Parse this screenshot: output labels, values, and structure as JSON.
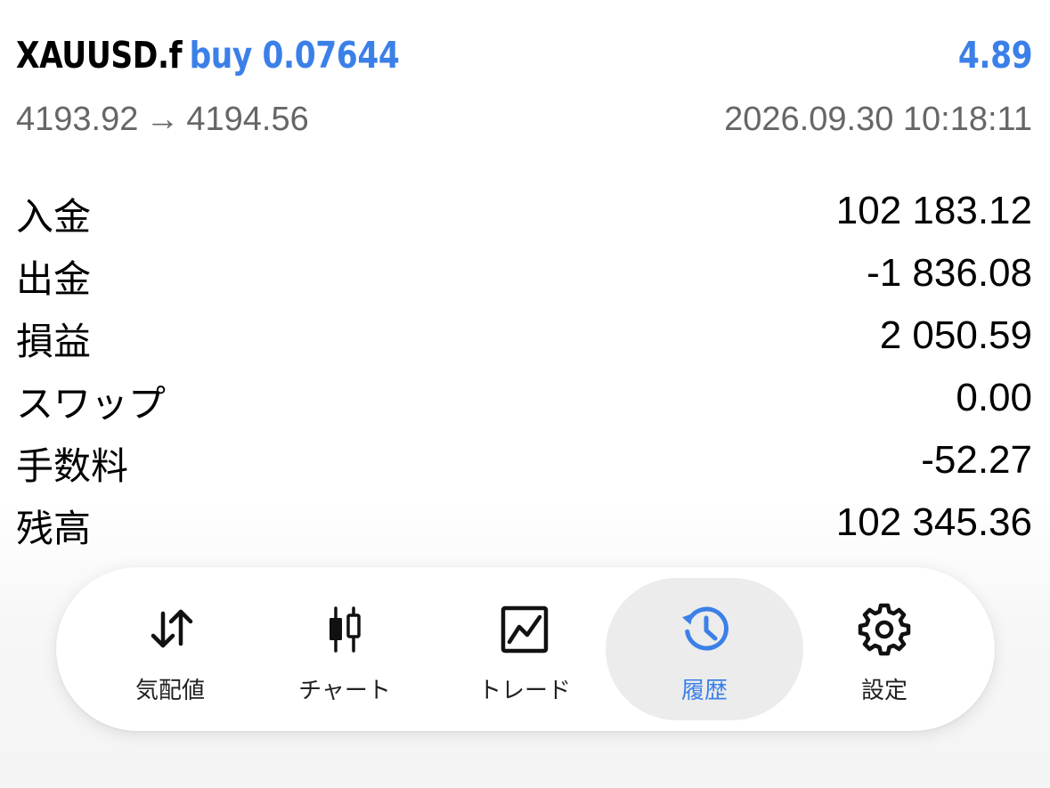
{
  "deal": {
    "symbol": "XAUUSD.f",
    "type_volume": "buy 0.07644",
    "profit": "4.89",
    "open_price": "4193.92",
    "arrow": "→",
    "close_price": "4194.56",
    "datetime": "2026.09.30 10:18:11"
  },
  "summary": [
    {
      "label": "入金",
      "value": "102 183.12"
    },
    {
      "label": "出金",
      "value": "-1 836.08"
    },
    {
      "label": "損益",
      "value": "2 050.59"
    },
    {
      "label": "スワップ",
      "value": "0.00"
    },
    {
      "label": "手数料",
      "value": "-52.27"
    },
    {
      "label": "残高",
      "value": "102 345.36"
    }
  ],
  "tabs": [
    {
      "label": "気配値",
      "icon": "quotes-arrows-icon"
    },
    {
      "label": "チャート",
      "icon": "candlestick-chart-icon"
    },
    {
      "label": "トレード",
      "icon": "trade-chart-icon"
    },
    {
      "label": "履歴",
      "icon": "history-clock-icon",
      "active": true
    },
    {
      "label": "設定",
      "icon": "gear-icon"
    }
  ],
  "colors": {
    "accent": "#3b80e8",
    "secondary_text": "#666666",
    "active_tab_bg": "#ececec"
  }
}
